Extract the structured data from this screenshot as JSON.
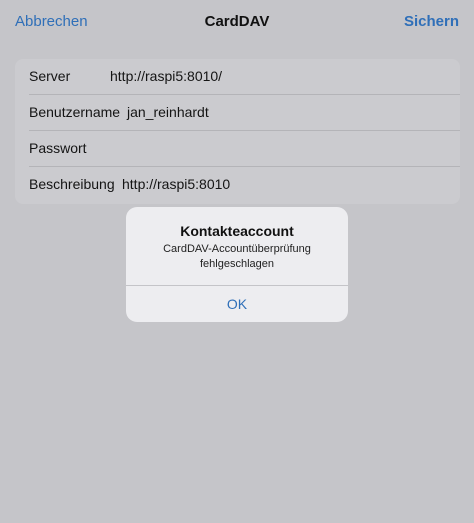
{
  "navbar": {
    "cancel_label": "Abbrechen",
    "title": "CardDAV",
    "save_label": "Sichern"
  },
  "form": {
    "rows": [
      {
        "label": "Server",
        "value": "http://raspi5:8010/"
      },
      {
        "label": "Benutzername",
        "value": "jan_reinhardt"
      },
      {
        "label": "Passwort",
        "value": ""
      },
      {
        "label": "Beschreibung",
        "value": "http://raspi5:8010"
      }
    ]
  },
  "alert": {
    "title": "Kontakteaccount",
    "message_line1": "CardDAV-Accountüberprüfung",
    "message_line2": "fehlgeschlagen",
    "ok_label": "OK"
  },
  "colors": {
    "background": "#c5c5c9",
    "accent": "#2f6fb8",
    "card": "#cbcbcf",
    "alert": "#ededf0"
  }
}
